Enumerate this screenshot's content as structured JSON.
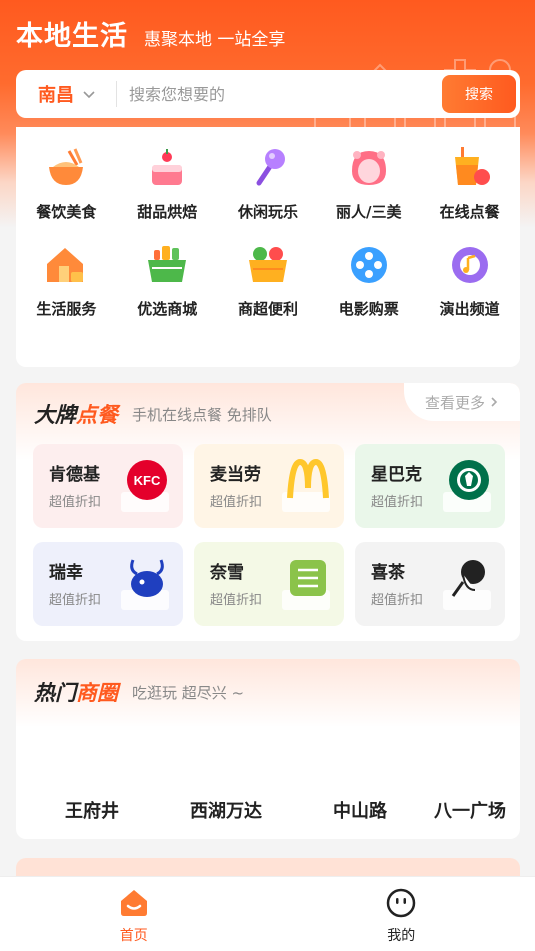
{
  "header": {
    "title": "本地生活",
    "slogan": "惠聚本地 一站全享"
  },
  "search": {
    "city": "南昌",
    "placeholder": "搜索您想要的",
    "button_label": "搜索"
  },
  "categories": [
    {
      "label": "餐饮美食",
      "icon": "food-bowl-icon"
    },
    {
      "label": "甜品烘焙",
      "icon": "cake-icon"
    },
    {
      "label": "休闲玩乐",
      "icon": "microphone-icon"
    },
    {
      "label": "丽人/三美",
      "icon": "beauty-icon"
    },
    {
      "label": "在线点餐",
      "icon": "drink-order-icon"
    },
    {
      "label": "生活服务",
      "icon": "house-service-icon"
    },
    {
      "label": "优选商城",
      "icon": "shopping-basket-icon"
    },
    {
      "label": "商超便利",
      "icon": "grocery-basket-icon"
    },
    {
      "label": "电影购票",
      "icon": "film-reel-icon"
    },
    {
      "label": "演出频道",
      "icon": "music-disc-icon"
    }
  ],
  "brand_section": {
    "title_plain": "大牌",
    "title_highlight": "点餐",
    "subtitle": "手机在线点餐 免排队",
    "more_label": "查看更多",
    "brands": [
      {
        "name": "肯德基",
        "sub": "超值折扣",
        "logo": "kfc-logo",
        "bg": "#fdeeee"
      },
      {
        "name": "麦当劳",
        "sub": "超值折扣",
        "logo": "mcdonalds-logo",
        "bg": "#fff5e6"
      },
      {
        "name": "星巴克",
        "sub": "超值折扣",
        "logo": "starbucks-logo",
        "bg": "#eaf7ea"
      },
      {
        "name": "瑞幸",
        "sub": "超值折扣",
        "logo": "luckin-logo",
        "bg": "#eef0fb"
      },
      {
        "name": "奈雪",
        "sub": "超值折扣",
        "logo": "naixue-logo",
        "bg": "#f4f9e6"
      },
      {
        "name": "喜茶",
        "sub": "超值折扣",
        "logo": "heytea-logo",
        "bg": "#f3f3f3"
      }
    ]
  },
  "hot_section": {
    "title_plain": "热门",
    "title_highlight": "商圈",
    "subtitle": "吃逛玩  超尽兴 ~",
    "items": [
      "王府井",
      "西湖万达",
      "中山路",
      "八一广场"
    ]
  },
  "tabbar": [
    {
      "label": "首页",
      "icon": "home-icon",
      "active": true
    },
    {
      "label": "我的",
      "icon": "smiley-profile-icon",
      "active": false
    }
  ],
  "colors": {
    "accent": "#ff5a1f",
    "header_bg": "#ff5a1f"
  }
}
